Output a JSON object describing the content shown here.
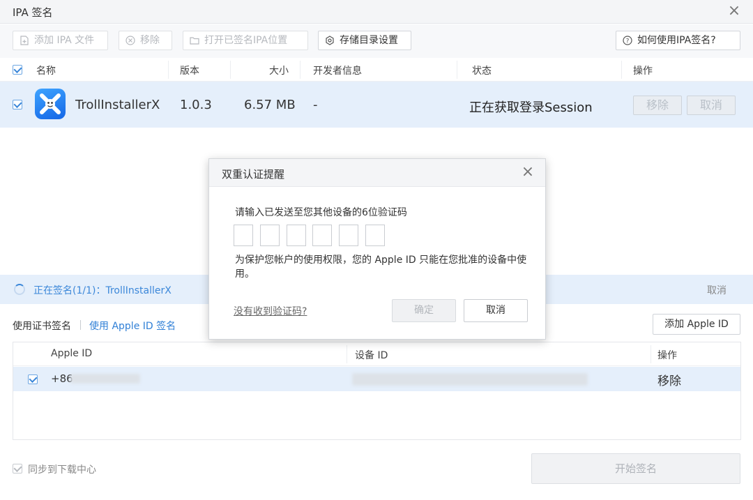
{
  "window": {
    "title": "IPA 签名",
    "close_icon": "×"
  },
  "toolbar": {
    "add_ipa": "添加 IPA 文件",
    "remove": "移除",
    "open_folder": "打开已签名IPA位置",
    "storage_settings": "存储目录设置",
    "help": "如何使用IPA签名?"
  },
  "table": {
    "headers": {
      "name": "名称",
      "version": "版本",
      "size": "大小",
      "developer": "开发者信息",
      "status": "状态",
      "action": "操作"
    },
    "rows": [
      {
        "name": "TrollInstallerX",
        "version": "1.0.3",
        "size": "6.57 MB",
        "developer": "-",
        "status": "正在获取登录Session",
        "remove": "移除",
        "cancel": "取消"
      }
    ]
  },
  "progress": {
    "text": "正在签名(1/1)：TrollInstallerX",
    "cancel": "取消"
  },
  "sign_method": {
    "cert": "使用证书签名",
    "apple_id": "使用 Apple ID 签名",
    "add_apple_id": "添加 Apple ID"
  },
  "id_table": {
    "headers": {
      "apple_id": "Apple ID",
      "device_id": "设备 ID",
      "action": "操作"
    },
    "rows": [
      {
        "apple_id": "+86",
        "action": "移除"
      }
    ]
  },
  "footer": {
    "sync": "同步到下载中心",
    "start": "开始签名"
  },
  "modal": {
    "title": "双重认证提醒",
    "prompt": "请输入已发送至您其他设备的6位验证码",
    "note": "为保护您帐户的使用权限，您的 Apple ID 只能在您批准的设备中使用。",
    "no_code_link": "没有收到验证码?",
    "confirm": "确定",
    "cancel": "取消"
  },
  "colors": {
    "accent": "#3b87d9",
    "selected_row": "#e5effb",
    "link": "#2f7fd6"
  }
}
